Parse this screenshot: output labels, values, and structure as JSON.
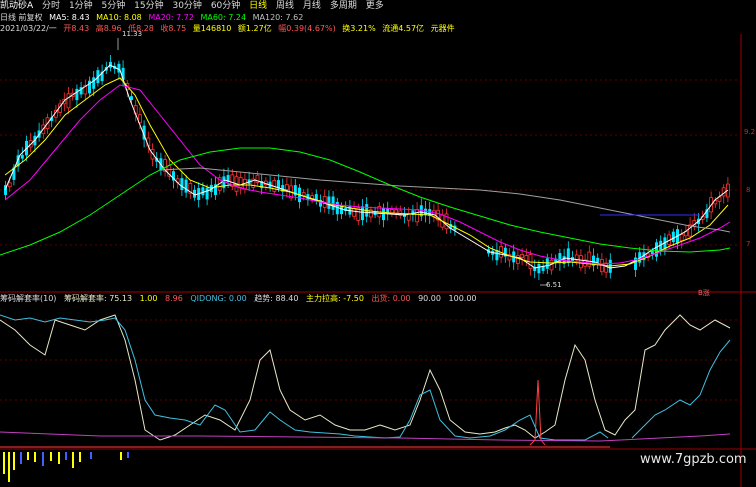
{
  "toolbar": {
    "stock_name": "凯动砂A",
    "periods": [
      "分时",
      "1分钟",
      "5分钟",
      "15分钟",
      "30分钟",
      "60分钟",
      "日线",
      "周线",
      "月线",
      "多周期",
      "更多"
    ]
  },
  "info_row1": {
    "adjust": "日线 前复权",
    "ma5": "MA5: 8.43",
    "ma10": "MA10: 8.08",
    "ma20": "MA20: 7.72",
    "ma60": "MA60: 7.24",
    "ma120": "MA120: 7.62"
  },
  "info_row2": {
    "date": "2021/03/22/一",
    "open": "开8.43",
    "high": "高8.96",
    "low": "低8.28",
    "close": "收8.75",
    "volume": "量146810",
    "amount": "额1.27亿",
    "change": "幅0.39(4.67%)",
    "turnover": "换3.21%",
    "float_cap": "流通4.57亿",
    "sector": "元器件"
  },
  "price_labels": {
    "peak": "11.33",
    "trough": "6.51",
    "right_upper": "9.2",
    "right_mid": "8",
    "right_lower": "7",
    "marker": "B涨"
  },
  "indicator": {
    "title": "筹码解套率(10)",
    "line1_name": "筹码解套率: 75.13",
    "line1_value2": "1.00",
    "line1_value3": "8.96",
    "qidong": "QIDONG: 0.00",
    "trend": "趋势: 88.40",
    "main_force": "主力拉高: -7.50",
    "exit": "出货: 0.00",
    "val90": "90.00",
    "val100": "100.00"
  },
  "watermark": "www.7gpzb.com",
  "colors": {
    "up": "#ff3333",
    "down": "#00e5ff",
    "ma5": "#ffffff",
    "ma10": "#ffff00",
    "ma20": "#ff00ff",
    "ma60": "#00ff00",
    "ma120": "#c0c0c0",
    "axis": "#a00000"
  }
}
